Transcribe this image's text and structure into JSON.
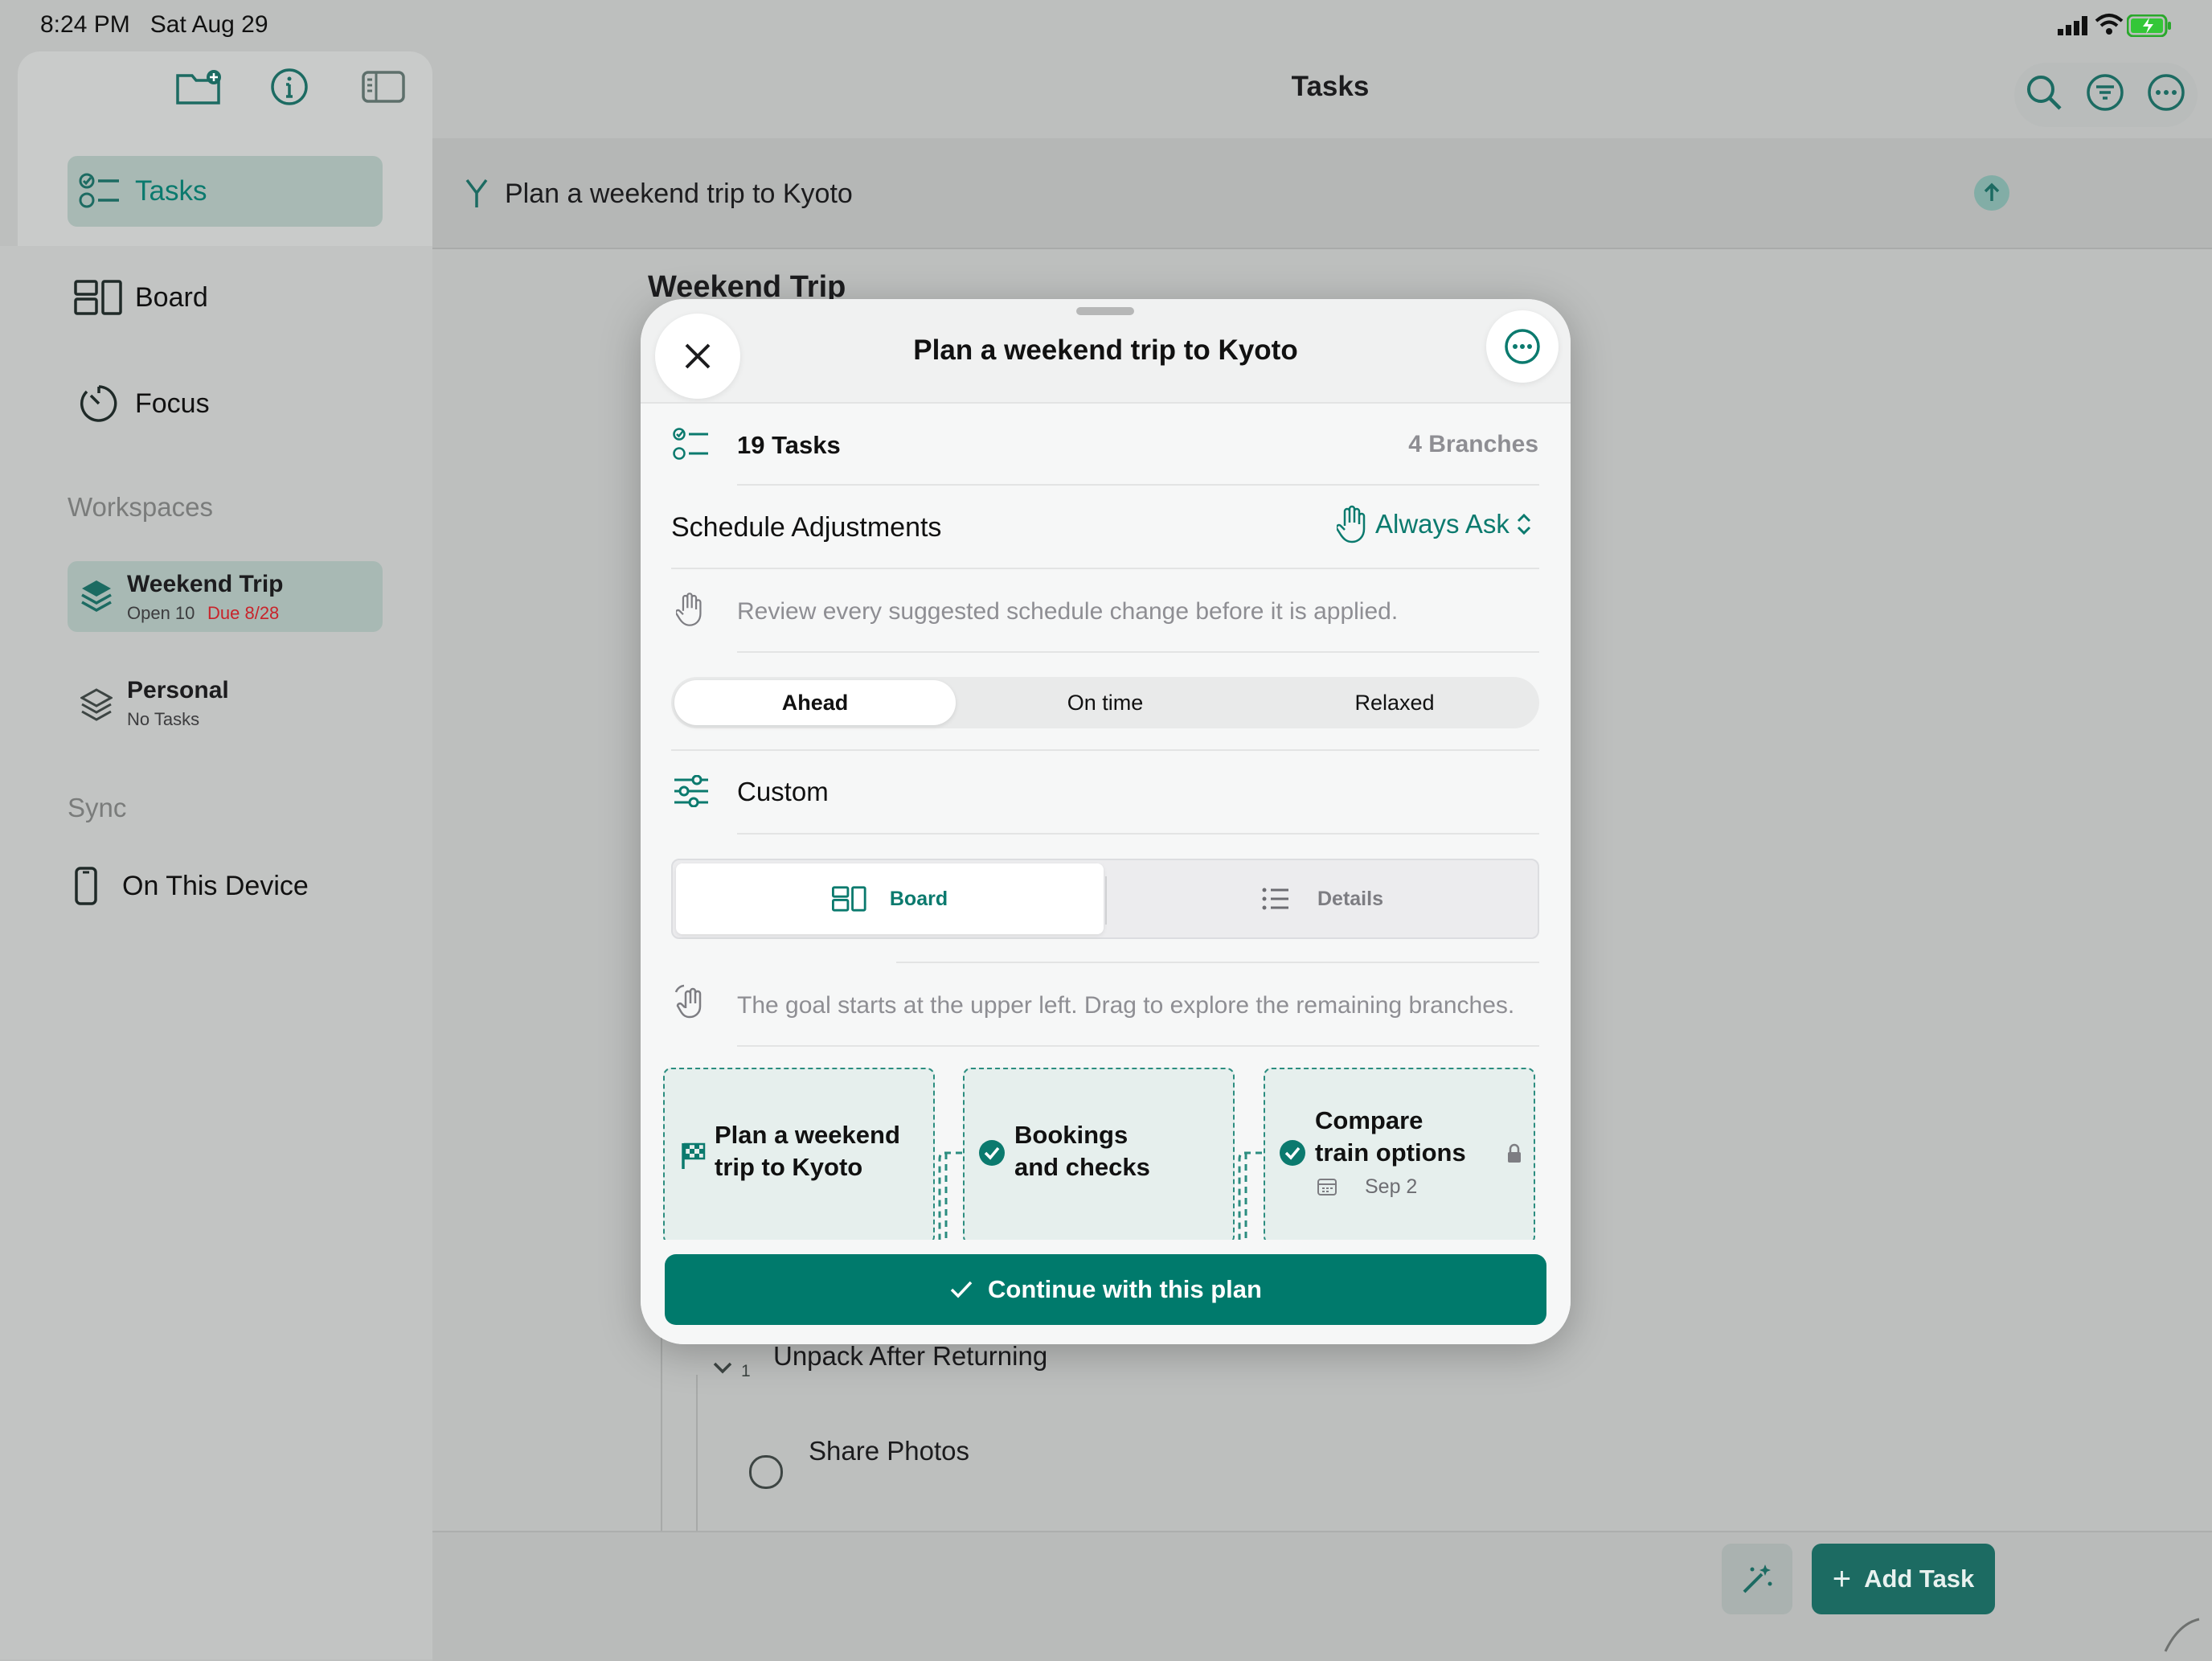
{
  "status_bar": {
    "time": "8:24 PM",
    "date": "Sat Aug 29"
  },
  "sidebar": {
    "items": [
      {
        "label": "Tasks",
        "icon": "checklist-icon"
      },
      {
        "label": "Board",
        "icon": "board-icon"
      },
      {
        "label": "Focus",
        "icon": "timer-icon"
      }
    ],
    "workspaces_heading": "Workspaces",
    "workspaces": [
      {
        "name": "Weekend Trip",
        "meta": "Open 10",
        "due": "Due 8/28"
      },
      {
        "name": "Personal",
        "meta": "No Tasks"
      }
    ],
    "sync_heading": "Sync",
    "sync_item": "On This Device"
  },
  "main": {
    "title": "Tasks",
    "goal": "Plan a weekend trip to Kyoto",
    "section_title": "Weekend Trip",
    "group_label": "Unpack After Returning",
    "group_count": "1",
    "task_label": "Share Photos",
    "add_task": "Add Task"
  },
  "modal": {
    "title": "Plan a weekend trip to Kyoto",
    "tasks_count": "19 Tasks",
    "branches_count": "4 Branches",
    "schedule_label": "Schedule Adjustments",
    "schedule_value": "Always Ask",
    "schedule_hint": "Review every suggested schedule change before it is applied.",
    "pace_options": [
      "Ahead",
      "On time",
      "Relaxed"
    ],
    "pace_selected": "Ahead",
    "custom_label": "Custom",
    "view_options": [
      "Board",
      "Details"
    ],
    "view_selected": "Board",
    "board_hint": "The goal starts at the upper left. Drag to explore the remaining branches.",
    "cards": [
      {
        "title_line1": "Plan a weekend",
        "title_line2": "trip to Kyoto",
        "icon": "finish-flag-icon"
      },
      {
        "title_line1": "Bookings",
        "title_line2": "and checks",
        "icon": "checkmark-circle-icon"
      },
      {
        "title_line1": "Compare",
        "title_line2": "train options",
        "date": "Sep 2",
        "icon": "checkmark-circle-icon"
      }
    ],
    "continue_label": "Continue with this plan"
  },
  "colors": {
    "accent": "#007a6c",
    "due_red": "#c8242b"
  }
}
